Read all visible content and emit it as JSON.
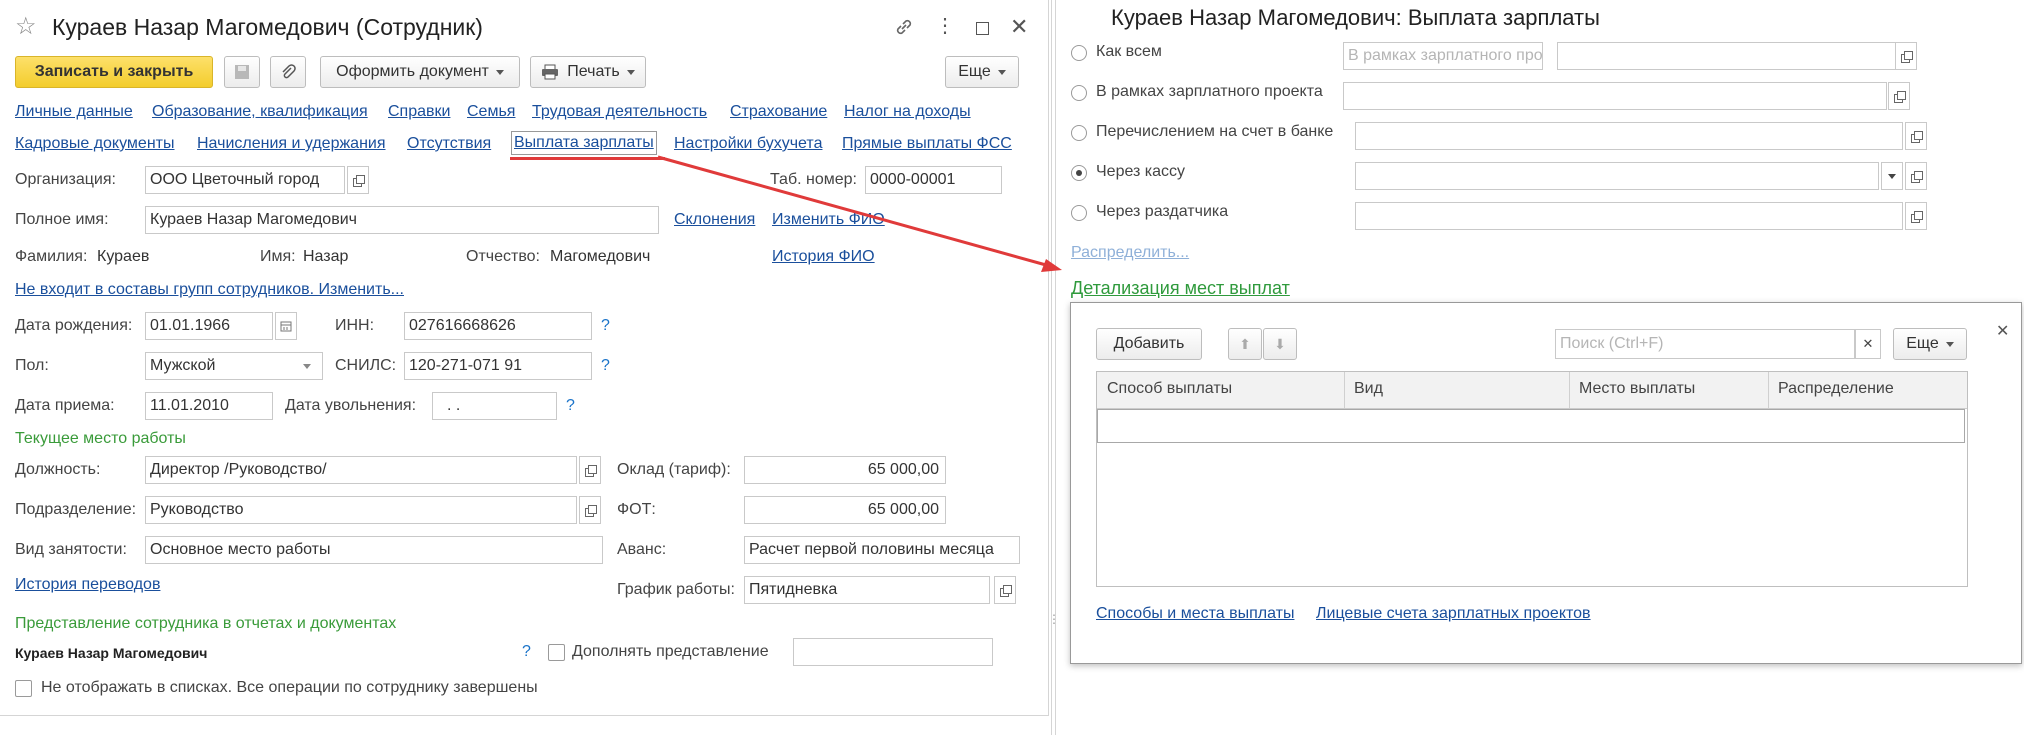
{
  "employee_form": {
    "title": "Кураев Назар Магомедович (Сотрудник)",
    "toolbar": {
      "save_close": "Записать и закрыть",
      "create_doc": "Оформить документ",
      "print": "Печать",
      "more": "Еще"
    },
    "nav_links_row1": [
      "Личные данные",
      "Образование, квалификация",
      "Справки",
      "Семья",
      "Трудовая деятельность",
      "Страхование",
      "Налог на доходы"
    ],
    "nav_links_row2": [
      "Кадровые документы",
      "Начисления и удержания",
      "Отсутствия",
      "Выплата зарплаты",
      "Настройки бухучета",
      "Прямые выплаты ФСС"
    ],
    "organization": {
      "label": "Организация:",
      "value": "ООО Цветочный город"
    },
    "tab_number": {
      "label": "Таб. номер:",
      "value": "0000-00001"
    },
    "full_name": {
      "label": "Полное имя:",
      "value": "Кураев Назар Магомедович"
    },
    "declensions_link": "Склонения",
    "change_fio_link": "Изменить ФИО",
    "fio_history_link": "История ФИО",
    "surname": {
      "label": "Фамилия:",
      "value": "Кураев"
    },
    "first_name": {
      "label": "Имя:",
      "value": "Назар"
    },
    "patronymic": {
      "label": "Отчество:",
      "value": "Магомедович"
    },
    "groups_link": "Не входит в составы групп сотрудников. Изменить...",
    "birth_date": {
      "label": "Дата рождения:",
      "value": "01.01.1966"
    },
    "inn": {
      "label": "ИНН:",
      "value": "027616668626"
    },
    "gender": {
      "label": "Пол:",
      "value": "Мужской"
    },
    "snils": {
      "label": "СНИЛС:",
      "value": "120-271-071 91"
    },
    "hire_date": {
      "label": "Дата приема:",
      "value": "11.01.2010"
    },
    "dismissal_date": {
      "label": "Дата увольнения:",
      "value": " .  ."
    },
    "help_mark": "?",
    "current_job_header": "Текущее место работы",
    "position": {
      "label": "Должность:",
      "value": "Директор /Руководство/"
    },
    "salary": {
      "label": "Оклад (тариф):",
      "value": "65 000,00"
    },
    "department": {
      "label": "Подразделение:",
      "value": "Руководство"
    },
    "fot": {
      "label": "ФОТ:",
      "value": "65 000,00"
    },
    "employment_type": {
      "label": "Вид занятости:",
      "value": "Основное место работы"
    },
    "advance": {
      "label": "Аванс:",
      "value": "Расчет первой половины месяца"
    },
    "transfer_history_link": "История переводов",
    "schedule": {
      "label": "График работы:",
      "value": "Пятидневка"
    },
    "representation_header": "Представление сотрудника в отчетах и документах",
    "representation_value": "Кураев Назар Магомедович",
    "supplement_label": "Дополнять представление",
    "hide_label": "Не отображать в списках. Все операции по сотруднику завершены"
  },
  "salary_panel": {
    "title": "Кураев Назар Магомедович: Выплата зарплаты",
    "options": [
      {
        "label": "Как всем",
        "selected": false
      },
      {
        "label": "В рамках зарплатного проекта",
        "selected": false
      },
      {
        "label": "Перечислением на счет в банке",
        "selected": false
      },
      {
        "label": "Через кассу",
        "selected": true
      },
      {
        "label": "Через раздатчика",
        "selected": false
      }
    ],
    "option1_placeholder": "В рамках зарплатного про",
    "distribute_link": "Распределить...",
    "details_link": "Детализация мест выплат",
    "details": {
      "add_button": "Добавить",
      "search_placeholder": "Поиск (Ctrl+F)",
      "more": "Еще",
      "columns": [
        "Способ выплаты",
        "Вид",
        "Место выплаты",
        "Распределение"
      ],
      "footer_links": [
        "Способы и места выплаты",
        "Лицевые счета зарплатных проектов"
      ]
    }
  },
  "colors": {
    "accent_yellow": "#f5d23c",
    "link": "#1a4f9c",
    "group_green": "#3a9b3a",
    "arrow_red": "#e03a3a"
  }
}
